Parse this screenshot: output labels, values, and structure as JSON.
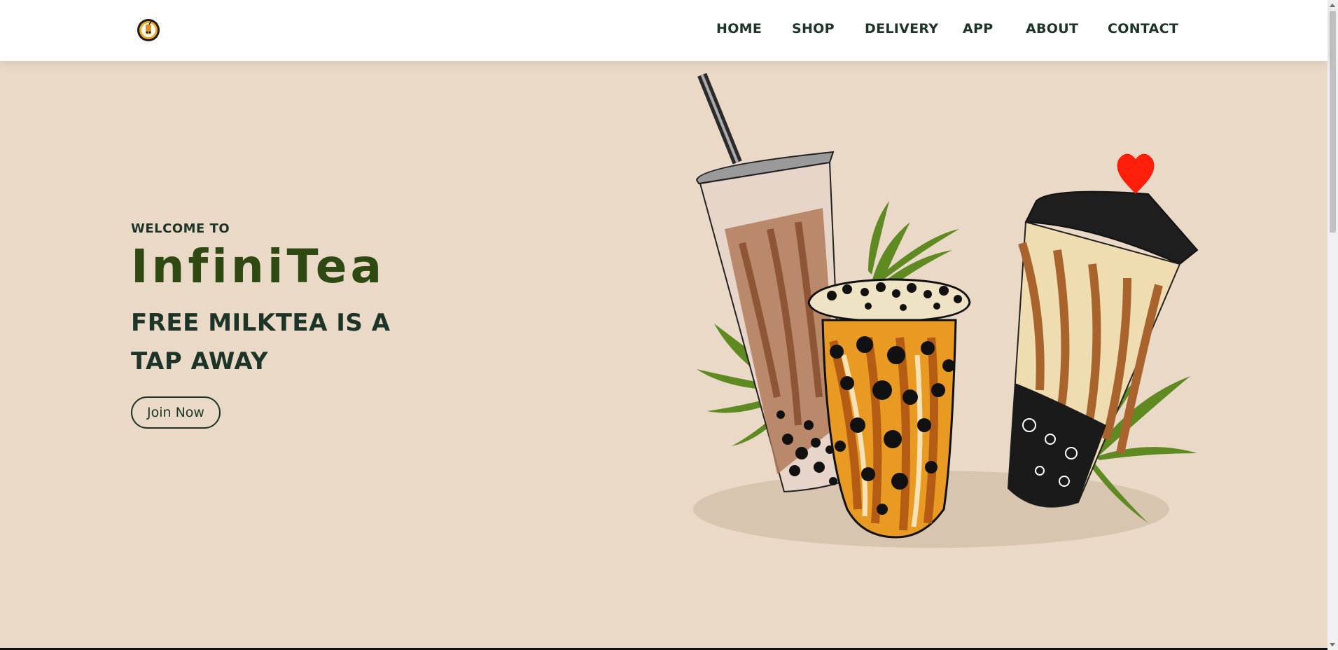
{
  "nav": {
    "logo_icon": "boba-cup-logo-icon",
    "links": [
      "HOME",
      "SHOP",
      "DELIVERY",
      "APP",
      "ABOUT",
      "CONTACT"
    ]
  },
  "hero": {
    "welcome": "WELCOME TO",
    "brand": "InfiniTea",
    "tagline_line1": "FREE MILKTEA IS A",
    "tagline_line2": "TAP AWAY",
    "cta": "Join Now"
  },
  "colors": {
    "background": "#e9d9c6",
    "navbar": "#ffffff",
    "text_dark": "#1d3528",
    "brand_green": "#2e4a12",
    "heart_red": "#ff1e0a"
  }
}
